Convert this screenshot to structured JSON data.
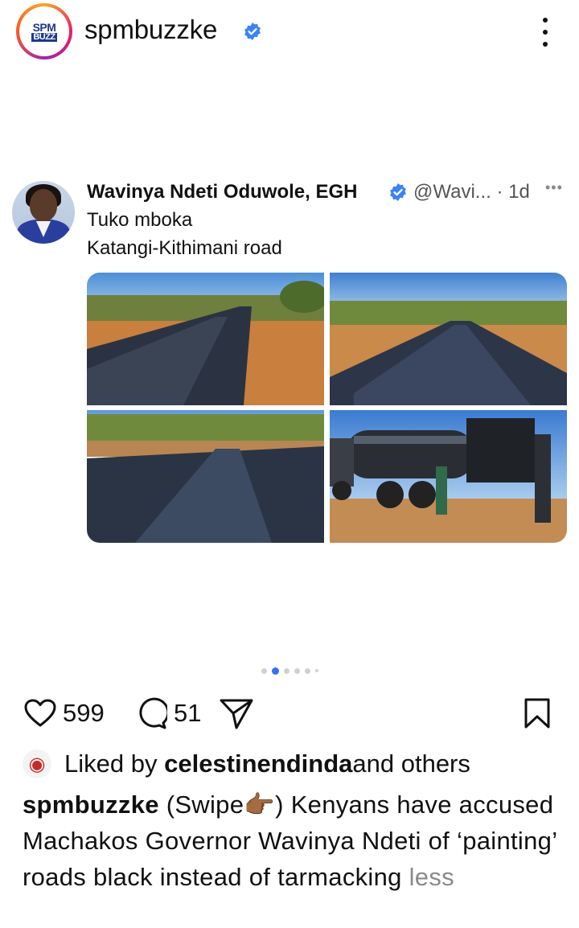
{
  "post": {
    "account": "spmbuzzke",
    "logo_top": "SPM",
    "logo_bottom": "BUZZ"
  },
  "tweet": {
    "name": "Wavinya Ndeti Oduwole, EGH",
    "handle": "@Wavi... · 1d",
    "more": "•••",
    "line1": "Tuko mboka",
    "line2": "Katangi-Kithimani road"
  },
  "carousel": {
    "count": 6,
    "active_index": 1
  },
  "actions": {
    "likes": "599",
    "comments": "51"
  },
  "liked_by": {
    "prefix": "Liked by ",
    "user": "celestinendinda",
    "suffix": " and others"
  },
  "caption": {
    "author": "spmbuzzke",
    "text": " (Swipe👉🏾) Kenyans have accused Machakos Governor Wavinya Ndeti of ‘painting’ roads black instead of tarmacking",
    "more_label": " less"
  },
  "colors": {
    "verified": "#3b82f6",
    "carousel_active": "#3b6df0",
    "text_muted": "#8a8a8a"
  },
  "icons": [
    "more-vertical-icon",
    "verified-badge-icon",
    "heart-icon",
    "comment-icon",
    "share-icon",
    "bookmark-icon"
  ]
}
